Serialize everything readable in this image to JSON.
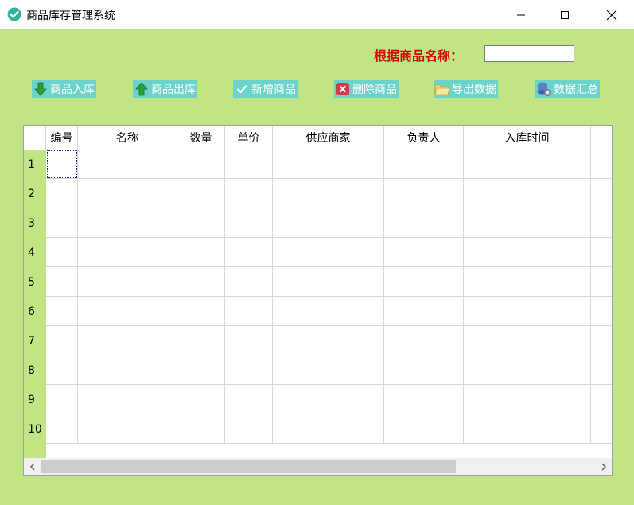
{
  "window": {
    "title": "商品库存管理系统"
  },
  "search": {
    "label": "根据商品名称：",
    "value": ""
  },
  "toolbar": {
    "buttons": [
      {
        "label": "商品入库",
        "icon": "arrow-down-green-icon"
      },
      {
        "label": "商品出库",
        "icon": "arrow-up-green-icon"
      },
      {
        "label": "新增商品",
        "icon": "check-icon"
      },
      {
        "label": "删除商品",
        "icon": "delete-x-icon"
      },
      {
        "label": "导出数据",
        "icon": "folder-icon"
      },
      {
        "label": "数据汇总",
        "icon": "database-gear-icon"
      }
    ]
  },
  "grid": {
    "columns": [
      "编号",
      "名称",
      "数量",
      "单价",
      "供应商家",
      "负责人",
      "入库时间"
    ],
    "row_numbers": [
      "1",
      "2",
      "3",
      "4",
      "5",
      "6",
      "7",
      "8",
      "9",
      "10"
    ]
  },
  "colors": {
    "background": "#c1e584",
    "button_bg": "#6bd3c9",
    "label_red": "#e00000"
  }
}
